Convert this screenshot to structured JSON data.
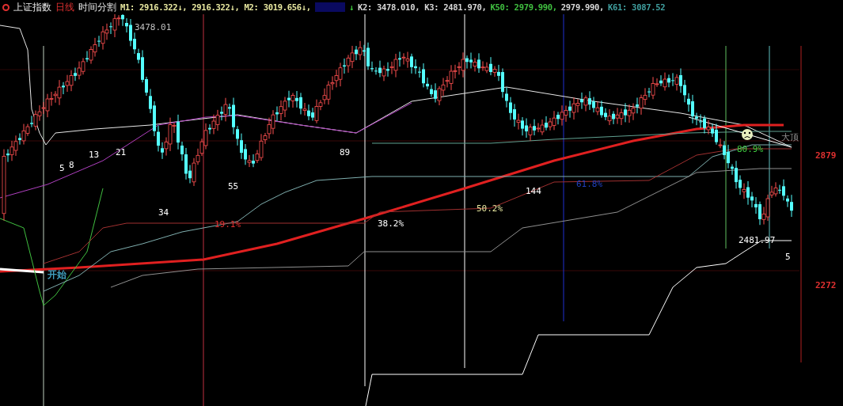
{
  "header": {
    "title": "上证指数",
    "period": "日线",
    "indicator": "时间分割",
    "values": [
      {
        "text": "M1: 2916.322↓, 2916.322↓, M2: 3019.656↓,",
        "color": "#e8e8a0"
      },
      {
        "text": "↓",
        "color": "#40d040"
      },
      {
        "text": "K2: 3478.010, K3: 2481.970,",
        "color": "#d8d8d8"
      },
      {
        "text": "K50: 2979.990,",
        "color": "#40c040"
      },
      {
        "text": "2979.990,",
        "color": "#d8d8d8"
      },
      {
        "text": "K61: 3087.52",
        "color": "#40a0a0"
      }
    ]
  },
  "chart": {
    "price_axis": [
      "2879",
      "2272"
    ],
    "labels": [
      {
        "text": "3478.01",
        "color": "#c0c0c0"
      },
      {
        "text": "5",
        "color": "#ffffff"
      },
      {
        "text": "8",
        "color": "#ffffff"
      },
      {
        "text": "13",
        "color": "#ffffff"
      },
      {
        "text": "21",
        "color": "#ffffff"
      },
      {
        "text": "34",
        "color": "#ffffff"
      },
      {
        "text": "55",
        "color": "#ffffff"
      },
      {
        "text": "89",
        "color": "#ffffff"
      },
      {
        "text": "144",
        "color": "#ffffff"
      },
      {
        "text": "5",
        "color": "#ffffff"
      },
      {
        "text": "开始",
        "color": "#40a0c0"
      },
      {
        "text": "19.1%",
        "color": "#e03030"
      },
      {
        "text": "38.2%",
        "color": "#ffffff"
      },
      {
        "text": "50.2%",
        "color": "#e8e8a0"
      },
      {
        "text": "61.8%",
        "color": "#2040c0"
      },
      {
        "text": "80.9%",
        "color": "#40d040"
      },
      {
        "text": "2481.97",
        "color": "#ffffff"
      },
      {
        "text": "大顶",
        "color": "#909090"
      }
    ]
  }
}
